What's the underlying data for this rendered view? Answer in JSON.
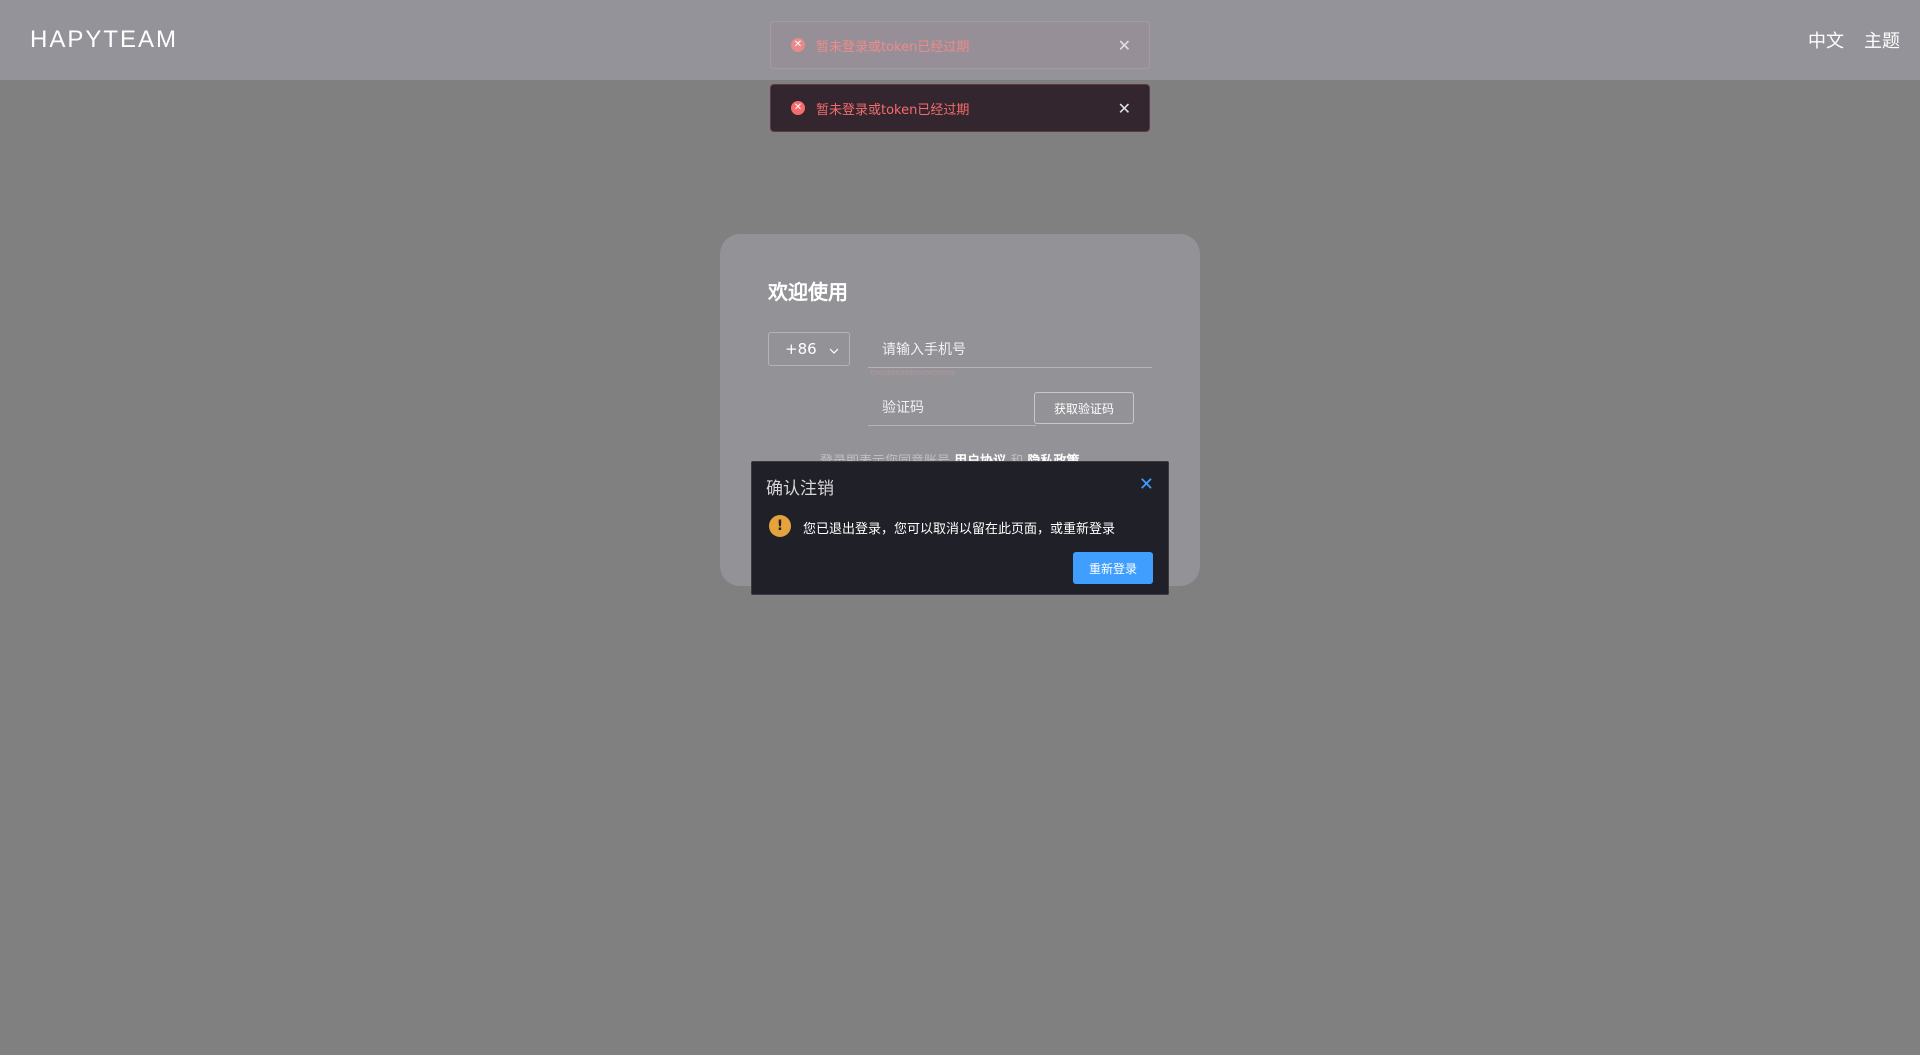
{
  "header": {
    "logo": "HAPYTEAM",
    "language": "中文",
    "theme": "主题"
  },
  "toasts": [
    {
      "message": "暂未登录或token已经过期"
    },
    {
      "message": "暂未登录或token已经过期"
    }
  ],
  "login": {
    "title": "欢迎使用",
    "country_code": "+86",
    "phone_placeholder": "请输入手机号",
    "code_placeholder": "验证码",
    "get_code_label": "获取验证码",
    "agree_prefix": "登录即表示您同意账号",
    "user_agreement": "用户协议",
    "and": "和",
    "privacy_policy": "隐私政策"
  },
  "dialog": {
    "title": "确认注销",
    "message": "您已退出登录，您可以取消以留在此页面，或重新登录",
    "relogin_label": "重新登录"
  },
  "colors": {
    "accent": "#409eff",
    "error": "#f56c6c",
    "warning": "#e6a23c"
  }
}
